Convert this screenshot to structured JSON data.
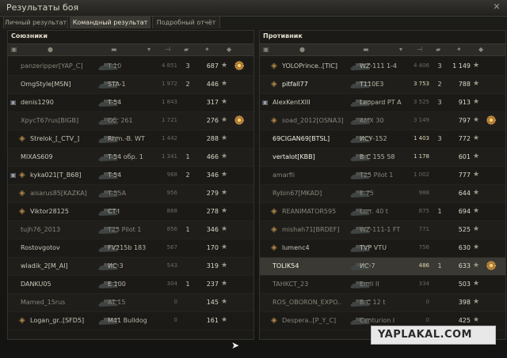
{
  "window": {
    "title": "Результаты боя",
    "close_label": "✕"
  },
  "tabs": [
    {
      "label": "Личный результат",
      "active": false
    },
    {
      "label": "Командный результат",
      "active": true
    },
    {
      "label": "Подробный отчёт",
      "active": false
    }
  ],
  "allies": {
    "title": "Союзники",
    "rows": [
      {
        "name": "panzeripper[YAP_C]",
        "tank": "T-10",
        "damage": "4 851",
        "kills": "3",
        "xp": "687",
        "medal": true,
        "dead": true
      },
      {
        "name": "OmgStyle[MSN]",
        "tank": "STA-1",
        "damage": "1 972",
        "kills": "2",
        "xp": "446",
        "medal": false,
        "dead": false
      },
      {
        "name": "denis1290",
        "tank": "T-54",
        "damage": "1 843",
        "kills": "",
        "xp": "317",
        "medal": false,
        "dead": false,
        "badge": true
      },
      {
        "name": "XpycT67rus[BIGB]",
        "tank": "Об. 261",
        "damage": "1 721",
        "kills": "",
        "xp": "276",
        "medal": true,
        "dead": true
      },
      {
        "name": "Strelok_[_CTV_]",
        "tank": "Rhm.-B. WT",
        "damage": "1 442",
        "kills": "",
        "xp": "288",
        "medal": false,
        "dead": false,
        "clan": true
      },
      {
        "name": "MIXAS609",
        "tank": "T-54 обр. 1",
        "damage": "1 341",
        "kills": "1",
        "xp": "466",
        "medal": false,
        "dead": false
      },
      {
        "name": "kyka021[T_B68]",
        "tank": "T-54",
        "damage": "968",
        "kills": "2",
        "xp": "346",
        "medal": false,
        "dead": false,
        "badge": true,
        "clan": true
      },
      {
        "name": "aisarus85[KAZKA]",
        "tank": "T 55A",
        "damage": "956",
        "kills": "",
        "xp": "279",
        "medal": false,
        "dead": true,
        "clan": true
      },
      {
        "name": "Viktor28125",
        "tank": "CT-I",
        "damage": "868",
        "kills": "",
        "xp": "278",
        "medal": false,
        "dead": false,
        "clan": true
      },
      {
        "name": "tujh76_2013",
        "tank": "T25 Pilot 1",
        "damage": "856",
        "kills": "1",
        "xp": "346",
        "medal": false,
        "dead": true
      },
      {
        "name": "Rostovgotov",
        "tank": "FV215b 183",
        "damage": "567",
        "kills": "",
        "xp": "170",
        "medal": false,
        "dead": false
      },
      {
        "name": "wladik_2[M_AI]",
        "tank": "ИС-3",
        "damage": "543",
        "kills": "",
        "xp": "319",
        "medal": false,
        "dead": false
      },
      {
        "name": "DANKU05",
        "tank": "E 100",
        "damage": "304",
        "kills": "1",
        "xp": "237",
        "medal": false,
        "dead": false
      },
      {
        "name": "Mamed_15rus",
        "tank": "AT 15",
        "damage": "0",
        "kills": "",
        "xp": "145",
        "medal": false,
        "dead": true
      },
      {
        "name": "Logan_gr..[SFD5]",
        "tank": "M41 Bulldog",
        "damage": "0",
        "kills": "",
        "xp": "161",
        "medal": false,
        "dead": false,
        "clan": true
      }
    ]
  },
  "enemies": {
    "title": "Противник",
    "rows": [
      {
        "name": "YOLOPrince..[TIC]",
        "tank": "WZ-111 1-4",
        "damage": "4 406",
        "kills": "3",
        "xp": "1 149",
        "medal": false,
        "dead": false,
        "clan": true
      },
      {
        "name": "pitfall77",
        "tank": "T110E3",
        "damage": "3 753",
        "kills": "2",
        "xp": "788",
        "medal": false,
        "dead": false,
        "clan": true,
        "bright": true
      },
      {
        "name": "AlexKentXIII",
        "tank": "Leopard PT A",
        "damage": "3 525",
        "kills": "3",
        "xp": "913",
        "medal": false,
        "dead": false,
        "badge": true
      },
      {
        "name": "soad_2012[OSNA3]",
        "tank": "AMX 30",
        "damage": "3 149",
        "kills": "",
        "xp": "797",
        "medal": true,
        "dead": true,
        "clan": true
      },
      {
        "name": "69CIGAN69[BTSL]",
        "tank": "ИСУ-152",
        "damage": "1 403",
        "kills": "3",
        "xp": "772",
        "medal": false,
        "dead": false,
        "bright": true
      },
      {
        "name": "vertalot[KBB]",
        "tank": "B-C 155 58",
        "damage": "1 178",
        "kills": "",
        "xp": "601",
        "medal": false,
        "dead": false,
        "bright": true
      },
      {
        "name": "amarfii",
        "tank": "T25 Pilot 1",
        "damage": "1 002",
        "kills": "",
        "xp": "777",
        "medal": false,
        "dead": true
      },
      {
        "name": "Rybin67[MKAD]",
        "tank": "E 75",
        "damage": "988",
        "kills": "",
        "xp": "644",
        "medal": false,
        "dead": true
      },
      {
        "name": "REANIMATOR595",
        "tank": "Lorr. 40 t",
        "damage": "875",
        "kills": "1",
        "xp": "694",
        "medal": false,
        "dead": true,
        "clan": true
      },
      {
        "name": "mishah71[BRDEF]",
        "tank": "WZ-111-1 FT",
        "damage": "771",
        "kills": "",
        "xp": "525",
        "medal": false,
        "dead": true,
        "clan": true
      },
      {
        "name": "lumenc4",
        "tank": "TVP VTU",
        "damage": "756",
        "kills": "",
        "xp": "630",
        "medal": false,
        "dead": false,
        "clan": true
      },
      {
        "name": "TOLIK54",
        "tank": "ИС-7",
        "damage": "486",
        "kills": "1",
        "xp": "633",
        "medal": true,
        "dead": false,
        "bright": true
      },
      {
        "name": "TAHKCT_23",
        "tank": "Emil II",
        "damage": "334",
        "kills": "",
        "xp": "503",
        "medal": false,
        "dead": true
      },
      {
        "name": "ROS_OBORON_EXPO..",
        "tank": "B-C 12 t",
        "damage": "0",
        "kills": "",
        "xp": "398",
        "medal": false,
        "dead": true
      },
      {
        "name": "Despera..[P_Y_C]",
        "tank": "Centurion I",
        "damage": "0",
        "kills": "",
        "xp": "425",
        "medal": false,
        "dead": true,
        "clan": true
      }
    ]
  },
  "watermark": "YAPLAKAL.COM",
  "colors": {
    "accent": "#b08848",
    "bright_text": "#f2eee0",
    "dim_text": "#8a857a"
  }
}
